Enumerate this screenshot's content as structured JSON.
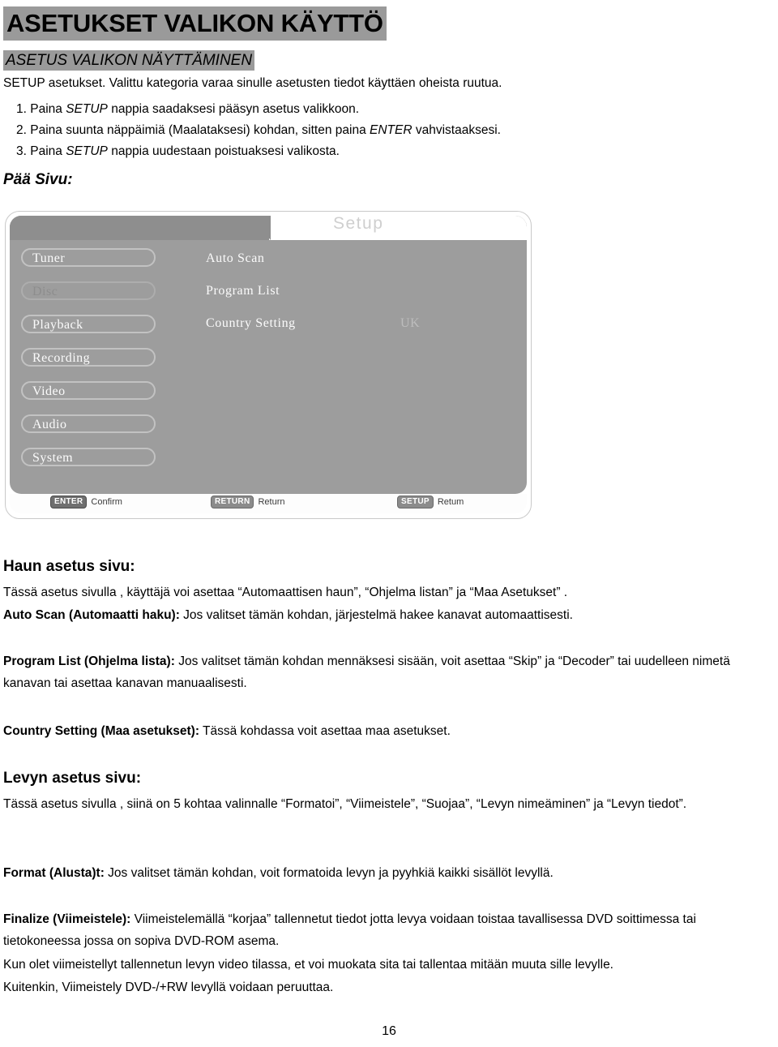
{
  "document": {
    "title": "ASETUKSET VALIKON KÄYTTÖ",
    "subtitle": "ASETUS VALIKON NÄYTTÄMINEN",
    "intro": "SETUP asetukset. Valittu kategoria varaa sinulle asetusten tiedot käyttäen oheista ruutua.",
    "steps": [
      {
        "num": "1.",
        "pre": "Paina ",
        "em": "SETUP",
        "post": " nappia saadaksesi pääsyn asetus valikkoon."
      },
      {
        "num": "2.",
        "pre": "Paina suunta näppäimiä (Maalataksesi) kohdan, sitten paina ",
        "em": "ENTER",
        "post": " vahvistaaksesi."
      },
      {
        "num": "3.",
        "pre": "Paina ",
        "em": "SETUP",
        "post": " nappia uudestaan poistuaksesi valikosta."
      }
    ],
    "figure_caption": "Pää Sivu:",
    "page_number": "16"
  },
  "osd": {
    "title": "Setup",
    "categories": [
      {
        "label": "Tuner",
        "disabled": false
      },
      {
        "label": "Disc",
        "disabled": true
      },
      {
        "label": "Playback",
        "disabled": false
      },
      {
        "label": "Recording",
        "disabled": false
      },
      {
        "label": "Video",
        "disabled": false
      },
      {
        "label": "Audio",
        "disabled": false
      },
      {
        "label": "System",
        "disabled": false
      }
    ],
    "rows": [
      {
        "label": "Auto Scan",
        "value": ""
      },
      {
        "label": "Program List",
        "value": ""
      },
      {
        "label": "Country Setting",
        "value": "UK"
      }
    ],
    "hints": [
      {
        "key": "ENTER",
        "text": "Confirm"
      },
      {
        "key": "RETURN",
        "text": "Return"
      },
      {
        "key": "SETUP",
        "text": "Retum"
      }
    ],
    "colors": {
      "panel": "#9d9d9d",
      "header_band": "#8e8e8e",
      "pill_border": "#c2c2c2",
      "text": "#fbfbfb",
      "dim_text": "#8d8d8d"
    }
  },
  "sections": [
    {
      "heading": "Haun asetus sivu:",
      "paragraphs": [
        {
          "lead": "",
          "text": "Tässä asetus sivulla , käyttäjä voi asettaa   “Automaattisen haun”, “Ohjelma listan” ja “Maa Asetukset” ."
        },
        {
          "lead": "Auto Scan (Automaatti haku):",
          "text": " Jos valitset tämän kohdan, järjestelmä hakee kanavat automaattisesti."
        },
        {
          "lead": "Program List (Ohjelma lista):",
          "text": " Jos valitset tämän kohdan mennäksesi sisään, voit asettaa “Skip” ja “Decoder” tai uudelleen nimetä kanavan tai asettaa kanavan manuaalisesti."
        },
        {
          "lead": "Country Setting (Maa asetukset):",
          "text": " Tässä kohdassa voit asettaa maa asetukset."
        }
      ]
    },
    {
      "heading": "Levyn asetus sivu:",
      "paragraphs": [
        {
          "lead": "",
          "text": "Tässä asetus sivulla , siinä on 5 kohtaa valinnalle “Formatoi”, “Viimeistele”, “Suojaa”, “Levyn nimeäminen” ja “Levyn tiedot”."
        },
        {
          "lead": "Format (Alusta)t:",
          "text": " Jos valitset tämän kohdan, voit formatoida levyn ja pyyhkiä kaikki sisällöt levyllä."
        },
        {
          "lead": "Finalize (Viimeistele):",
          "text": " Viimeistelemällä “korjaa” tallennetut tiedot jotta levya voidaan toistaa tavallisessa DVD soittimessa tai tietokoneessa jossa on sopiva DVD-ROM asema."
        },
        {
          "lead": "",
          "text": "Kun olet viimeistellyt tallennetun levyn video tilassa, et voi muokata sita tai tallentaa mitään muuta sille levylle."
        },
        {
          "lead": "",
          "text": "Kuitenkin, Viimeistely DVD-/+RW levyllä voidaan peruuttaa."
        }
      ]
    }
  ]
}
